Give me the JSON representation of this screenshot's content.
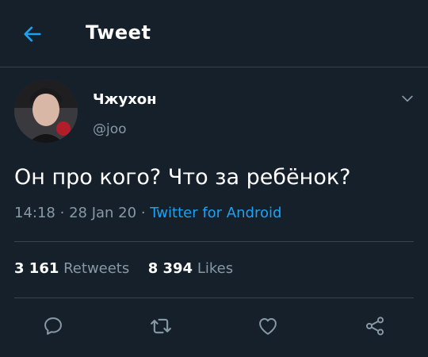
{
  "header": {
    "title": "Tweet",
    "back_icon": "arrow-left-icon"
  },
  "tweet": {
    "display_name": "Чжухон",
    "handle": "@joo",
    "text": "Он про кого? Что за ребёнок?",
    "time": "14:18",
    "date": "28 Jan 20",
    "separator": "·",
    "source": "Twitter for Android",
    "retweets_count": "3 161",
    "retweets_label": "Retweets",
    "likes_count": "8 394",
    "likes_label": "Likes"
  },
  "actions": [
    {
      "name": "reply",
      "icon": "reply-icon"
    },
    {
      "name": "retweet",
      "icon": "retweet-icon"
    },
    {
      "name": "like",
      "icon": "heart-icon"
    },
    {
      "name": "share",
      "icon": "share-icon"
    }
  ],
  "colors": {
    "background": "#15202b",
    "accent": "#1da1f2",
    "secondary_text": "#8899a6",
    "divider": "#38444d"
  }
}
